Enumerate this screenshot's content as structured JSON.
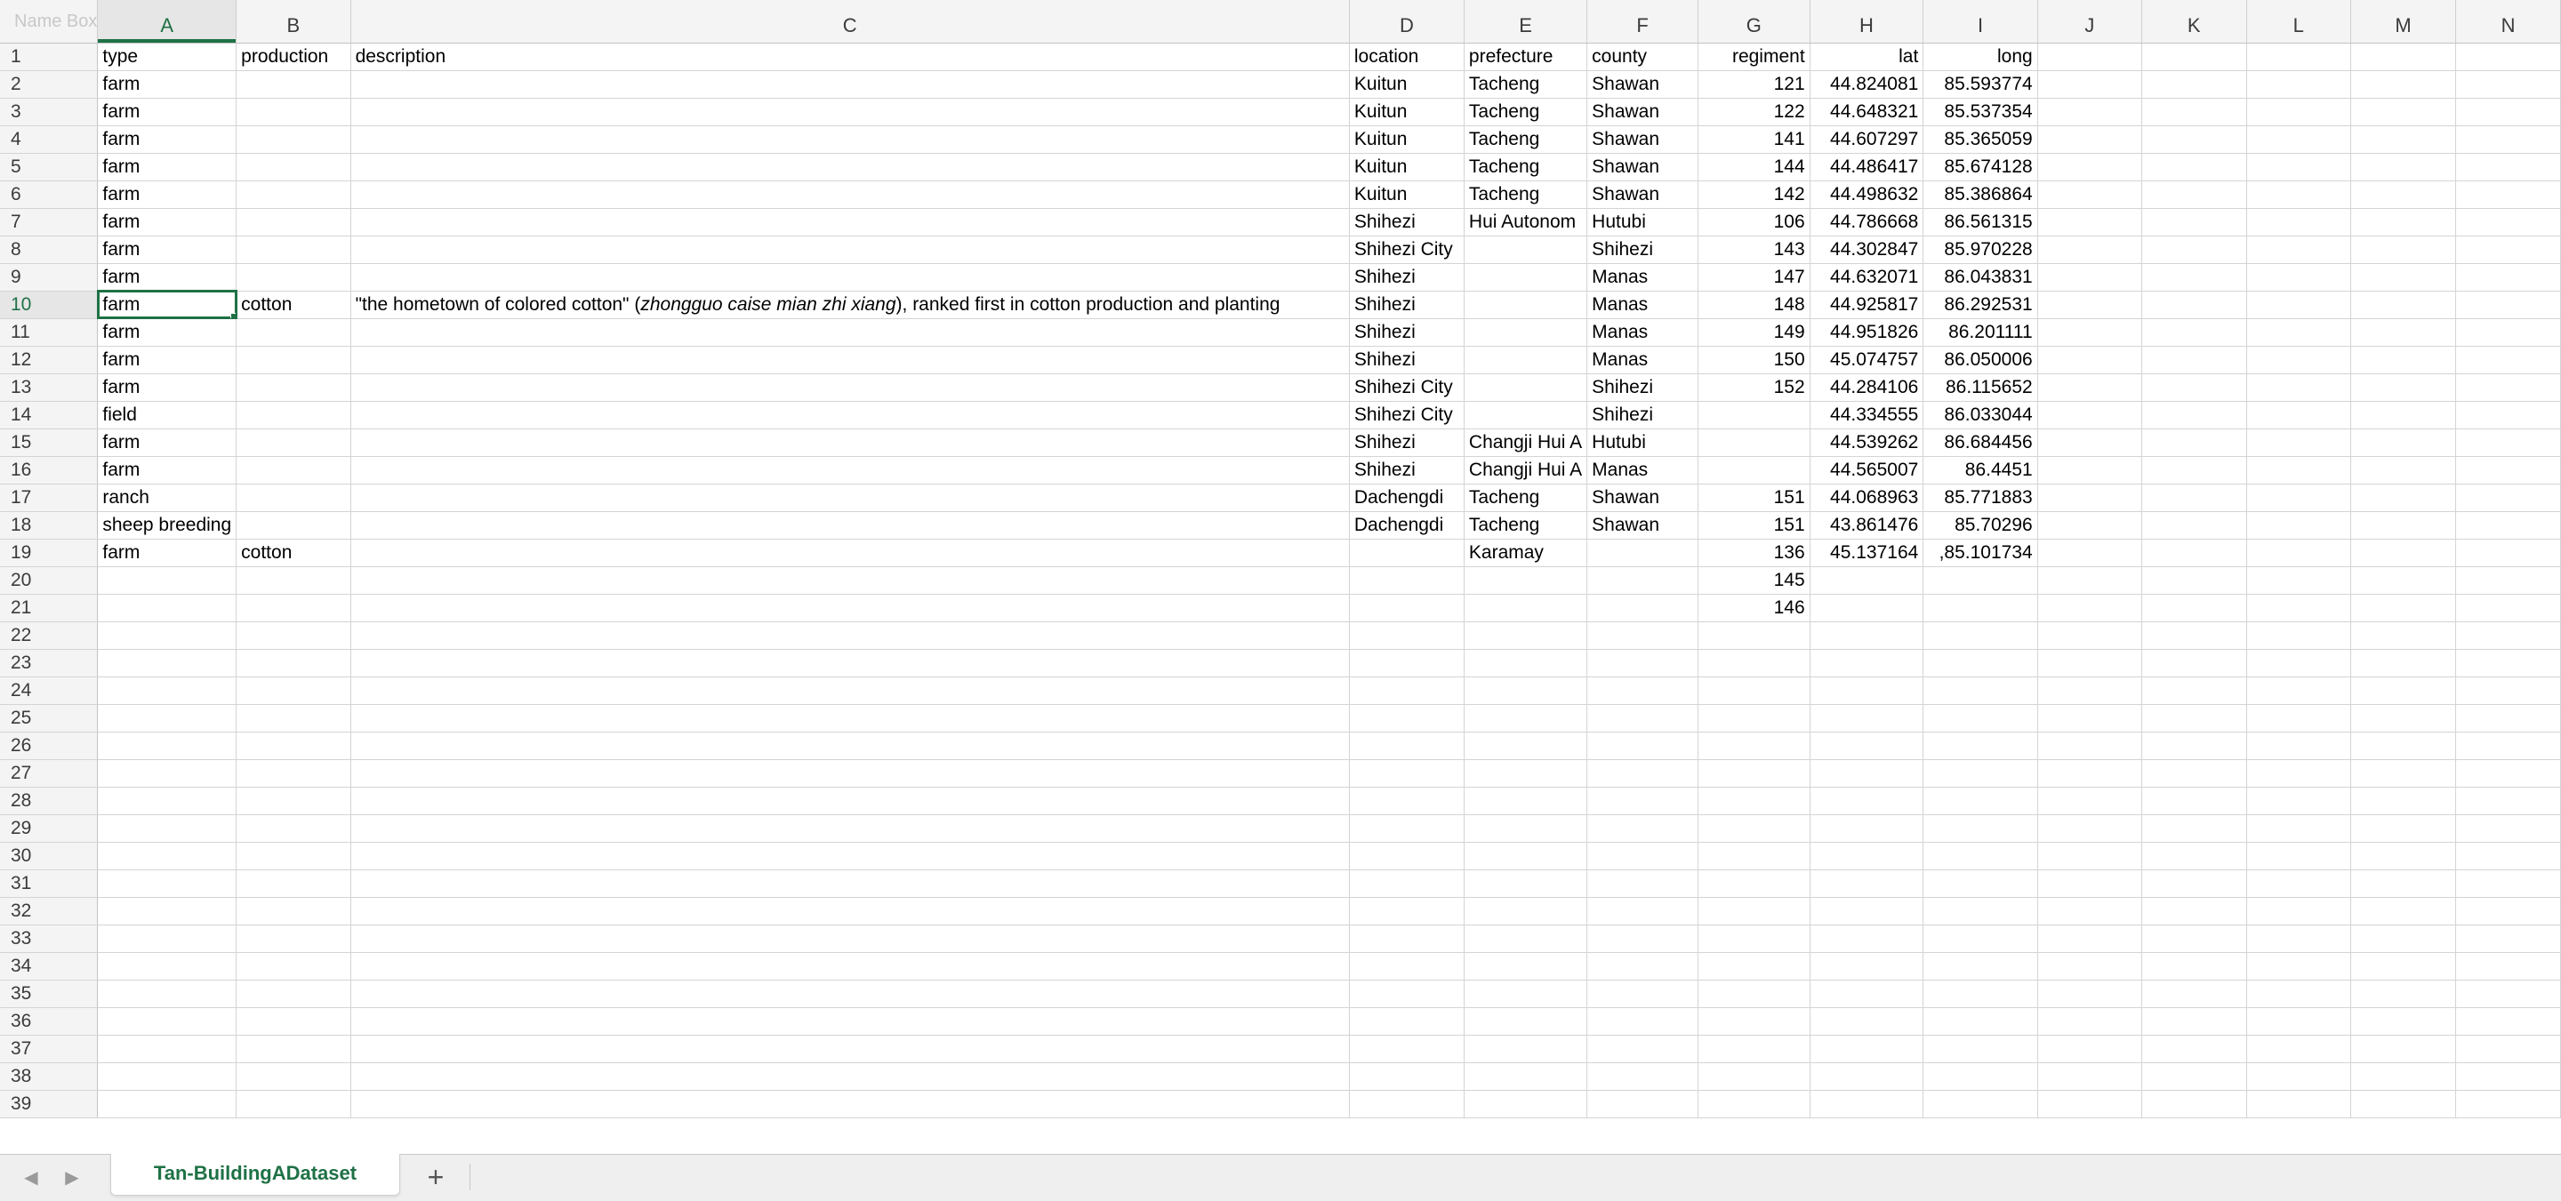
{
  "name_box": {
    "value": "Name Box"
  },
  "columns": [
    "A",
    "B",
    "C",
    "D",
    "E",
    "F",
    "G",
    "H",
    "I",
    "J",
    "K",
    "L",
    "M",
    "N"
  ],
  "active_cell": {
    "column": "A",
    "row": 10
  },
  "rows": [
    {
      "n": "1",
      "A": "type",
      "B": "production",
      "C": "description",
      "D": "location",
      "E": "prefecture",
      "F": "county",
      "G": "regiment",
      "H": "lat",
      "I": "long"
    },
    {
      "n": "2",
      "A": "farm",
      "D": "Kuitun",
      "E": "Tacheng",
      "F": "Shawan",
      "G": "121",
      "H": "44.824081",
      "I": "85.593774"
    },
    {
      "n": "3",
      "A": "farm",
      "D": "Kuitun",
      "E": "Tacheng",
      "F": "Shawan",
      "G": "122",
      "H": "44.648321",
      "I": "85.537354"
    },
    {
      "n": "4",
      "A": "farm",
      "D": "Kuitun",
      "E": "Tacheng",
      "F": "Shawan",
      "G": "141",
      "H": "44.607297",
      "I": "85.365059"
    },
    {
      "n": "5",
      "A": "farm",
      "D": "Kuitun",
      "E": "Tacheng",
      "F": "Shawan",
      "G": "144",
      "H": "44.486417",
      "I": "85.674128"
    },
    {
      "n": "6",
      "A": "farm",
      "D": "Kuitun",
      "E": "Tacheng",
      "F": "Shawan",
      "G": "142",
      "H": "44.498632",
      "I": "85.386864"
    },
    {
      "n": "7",
      "A": "farm",
      "D": "Shihezi",
      "E": "Hui Autonom",
      "F": "Hutubi",
      "G": "106",
      "H": "44.786668",
      "I": "86.561315"
    },
    {
      "n": "8",
      "A": "farm",
      "D": "Shihezi City",
      "F": "Shihezi",
      "G": "143",
      "H": "44.302847",
      "I": "85.970228"
    },
    {
      "n": "9",
      "A": "farm",
      "D": "Shihezi",
      "F": "Manas",
      "G": "147",
      "H": "44.632071",
      "I": "86.043831"
    },
    {
      "n": "10",
      "A": "farm",
      "B": "cotton",
      "C_pre": "\"the hometown of colored cotton\" (",
      "C_italic": "zhongguo caise mian zhi xiang",
      "C_post": "), ranked first in cotton production and planting",
      "D": "Shihezi",
      "F": "Manas",
      "G": "148",
      "H": "44.925817",
      "I": "86.292531"
    },
    {
      "n": "11",
      "A": "farm",
      "D": "Shihezi",
      "F": "Manas",
      "G": "149",
      "H": "44.951826",
      "I": "86.201111"
    },
    {
      "n": "12",
      "A": "farm",
      "D": "Shihezi",
      "F": "Manas",
      "G": "150",
      "H": "45.074757",
      "I": "86.050006"
    },
    {
      "n": "13",
      "A": "farm",
      "D": "Shihezi City",
      "F": "Shihezi",
      "G": "152",
      "H": "44.284106",
      "I": "86.115652"
    },
    {
      "n": "14",
      "A": "field",
      "D": "Shihezi City",
      "F": "Shihezi",
      "H": "44.334555",
      "I": "86.033044"
    },
    {
      "n": "15",
      "A": "farm",
      "D": "Shihezi",
      "E": "Changji Hui A",
      "F": "Hutubi",
      "H": "44.539262",
      "I": "86.684456"
    },
    {
      "n": "16",
      "A": "farm",
      "D": "Shihezi",
      "E": "Changji Hui A",
      "F": "Manas",
      "H": "44.565007",
      "I": "86.4451"
    },
    {
      "n": "17",
      "A": "ranch",
      "D": "Dachengdi",
      "E": "Tacheng",
      "F": "Shawan",
      "G": "151",
      "H": "44.068963",
      "I": "85.771883"
    },
    {
      "n": "18",
      "A": "sheep breeding",
      "D": "Dachengdi",
      "E": "Tacheng",
      "F": "Shawan",
      "G": "151",
      "H": "43.861476",
      "I": "85.70296"
    },
    {
      "n": "19",
      "A": "farm",
      "B": "cotton",
      "E": "Karamay",
      "G": "136",
      "H": "45.137164",
      "I": ",85.101734"
    },
    {
      "n": "20",
      "G": "145"
    },
    {
      "n": "21",
      "G": "146"
    },
    {
      "n": "22"
    },
    {
      "n": "23"
    },
    {
      "n": "24"
    },
    {
      "n": "25"
    },
    {
      "n": "26"
    },
    {
      "n": "27"
    },
    {
      "n": "28"
    },
    {
      "n": "29"
    },
    {
      "n": "30"
    },
    {
      "n": "31"
    },
    {
      "n": "32"
    },
    {
      "n": "33"
    },
    {
      "n": "34"
    },
    {
      "n": "35"
    },
    {
      "n": "36"
    },
    {
      "n": "37"
    },
    {
      "n": "38"
    },
    {
      "n": "39"
    }
  ],
  "tabs": {
    "sheet_name": "Tan-BuildingADataset",
    "add_label": "+",
    "prev_icon": "◀",
    "next_icon": "▶"
  },
  "colors": {
    "accent": "#1e7145",
    "gridline": "#d4d4d4",
    "header_bg": "#f4f4f4"
  }
}
